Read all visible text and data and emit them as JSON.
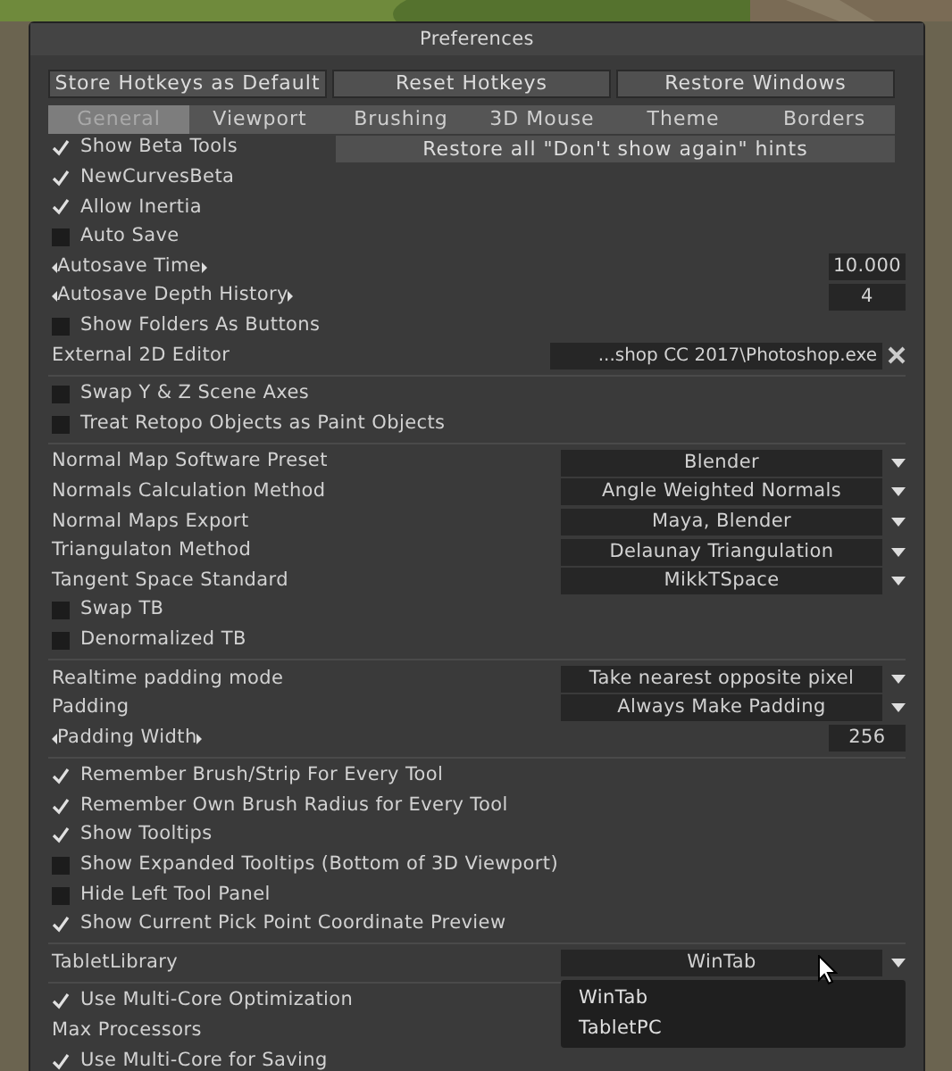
{
  "window": {
    "title": "Preferences"
  },
  "top_buttons": [
    "Store Hotkeys as Default",
    "Reset Hotkeys",
    "Restore Windows"
  ],
  "tabs": [
    {
      "label": "General",
      "selected": true
    },
    {
      "label": "Viewport",
      "selected": false
    },
    {
      "label": "Brushing",
      "selected": false
    },
    {
      "label": "3D Mouse",
      "selected": false
    },
    {
      "label": "Theme",
      "selected": false
    },
    {
      "label": "Borders",
      "selected": false
    }
  ],
  "rows": [
    {
      "kind": "checkbox",
      "label": "Show Beta Tools",
      "checked": true,
      "button": "Restore all \"Don't show again\" hints"
    },
    {
      "kind": "checkbox",
      "label": "NewCurvesBeta",
      "checked": true
    },
    {
      "kind": "checkbox",
      "label": "Allow Inertia",
      "checked": true
    },
    {
      "kind": "checkbox",
      "label": "Auto Save",
      "checked": false
    },
    {
      "kind": "spinner",
      "label": "Autosave Time",
      "value": "10.000"
    },
    {
      "kind": "spinner",
      "label": "Autosave Depth History",
      "value": "4"
    },
    {
      "kind": "checkbox",
      "label": "Show Folders As Buttons",
      "checked": false
    },
    {
      "kind": "file",
      "label": "External 2D Editor",
      "value": "...shop CC 2017\\Photoshop.exe"
    },
    {
      "kind": "separator"
    },
    {
      "kind": "checkbox",
      "label": "Swap Y & Z Scene Axes",
      "checked": false
    },
    {
      "kind": "checkbox",
      "label": "Treat Retopo Objects as Paint Objects",
      "checked": false
    },
    {
      "kind": "separator"
    },
    {
      "kind": "dropdown",
      "label": "Normal Map Software Preset",
      "value": "Blender",
      "expanded": false
    },
    {
      "kind": "dropdown",
      "label": "Normals Calculation Method",
      "value": "Angle Weighted Normals",
      "expanded": false
    },
    {
      "kind": "dropdown",
      "label": "Normal Maps Export",
      "value": "Maya, Blender",
      "expanded": false
    },
    {
      "kind": "dropdown",
      "label": "Triangulaton Method",
      "value": "Delaunay Triangulation",
      "expanded": false
    },
    {
      "kind": "dropdown",
      "label": "Tangent Space Standard",
      "value": "MikkTSpace",
      "expanded": false
    },
    {
      "kind": "checkbox",
      "label": "Swap TB",
      "checked": false
    },
    {
      "kind": "checkbox",
      "label": "Denormalized TB",
      "checked": false
    },
    {
      "kind": "separator"
    },
    {
      "kind": "dropdown",
      "label": "Realtime padding mode",
      "value": "Take nearest opposite pixel",
      "expanded": false
    },
    {
      "kind": "dropdown",
      "label": "Padding",
      "value": "Always Make Padding",
      "expanded": false
    },
    {
      "kind": "spinner",
      "label": "Padding Width",
      "value": "256"
    },
    {
      "kind": "separator"
    },
    {
      "kind": "checkbox",
      "label": "Remember Brush/Strip For Every Tool",
      "checked": true
    },
    {
      "kind": "checkbox",
      "label": "Remember Own Brush Radius for Every Tool",
      "checked": true
    },
    {
      "kind": "checkbox",
      "label": "Show Tooltips",
      "checked": true
    },
    {
      "kind": "checkbox",
      "label": "Show Expanded Tooltips (Bottom of 3D Viewport)",
      "checked": false
    },
    {
      "kind": "checkbox",
      "label": "Hide Left Tool Panel",
      "checked": false
    },
    {
      "kind": "checkbox",
      "label": "Show Current Pick Point Coordinate Preview",
      "checked": true
    },
    {
      "kind": "separator"
    },
    {
      "kind": "dropdown",
      "label": "TabletLibrary",
      "value": "WinTab",
      "expanded": true,
      "options": [
        "WinTab",
        "TabletPC"
      ]
    },
    {
      "kind": "separator"
    },
    {
      "kind": "checkbox",
      "label": "Use Multi-Core Optimization",
      "checked": true
    },
    {
      "kind": "label",
      "label": "Max Processors"
    },
    {
      "kind": "checkbox",
      "label": "Use Multi-Core for Saving",
      "checked": true
    }
  ]
}
